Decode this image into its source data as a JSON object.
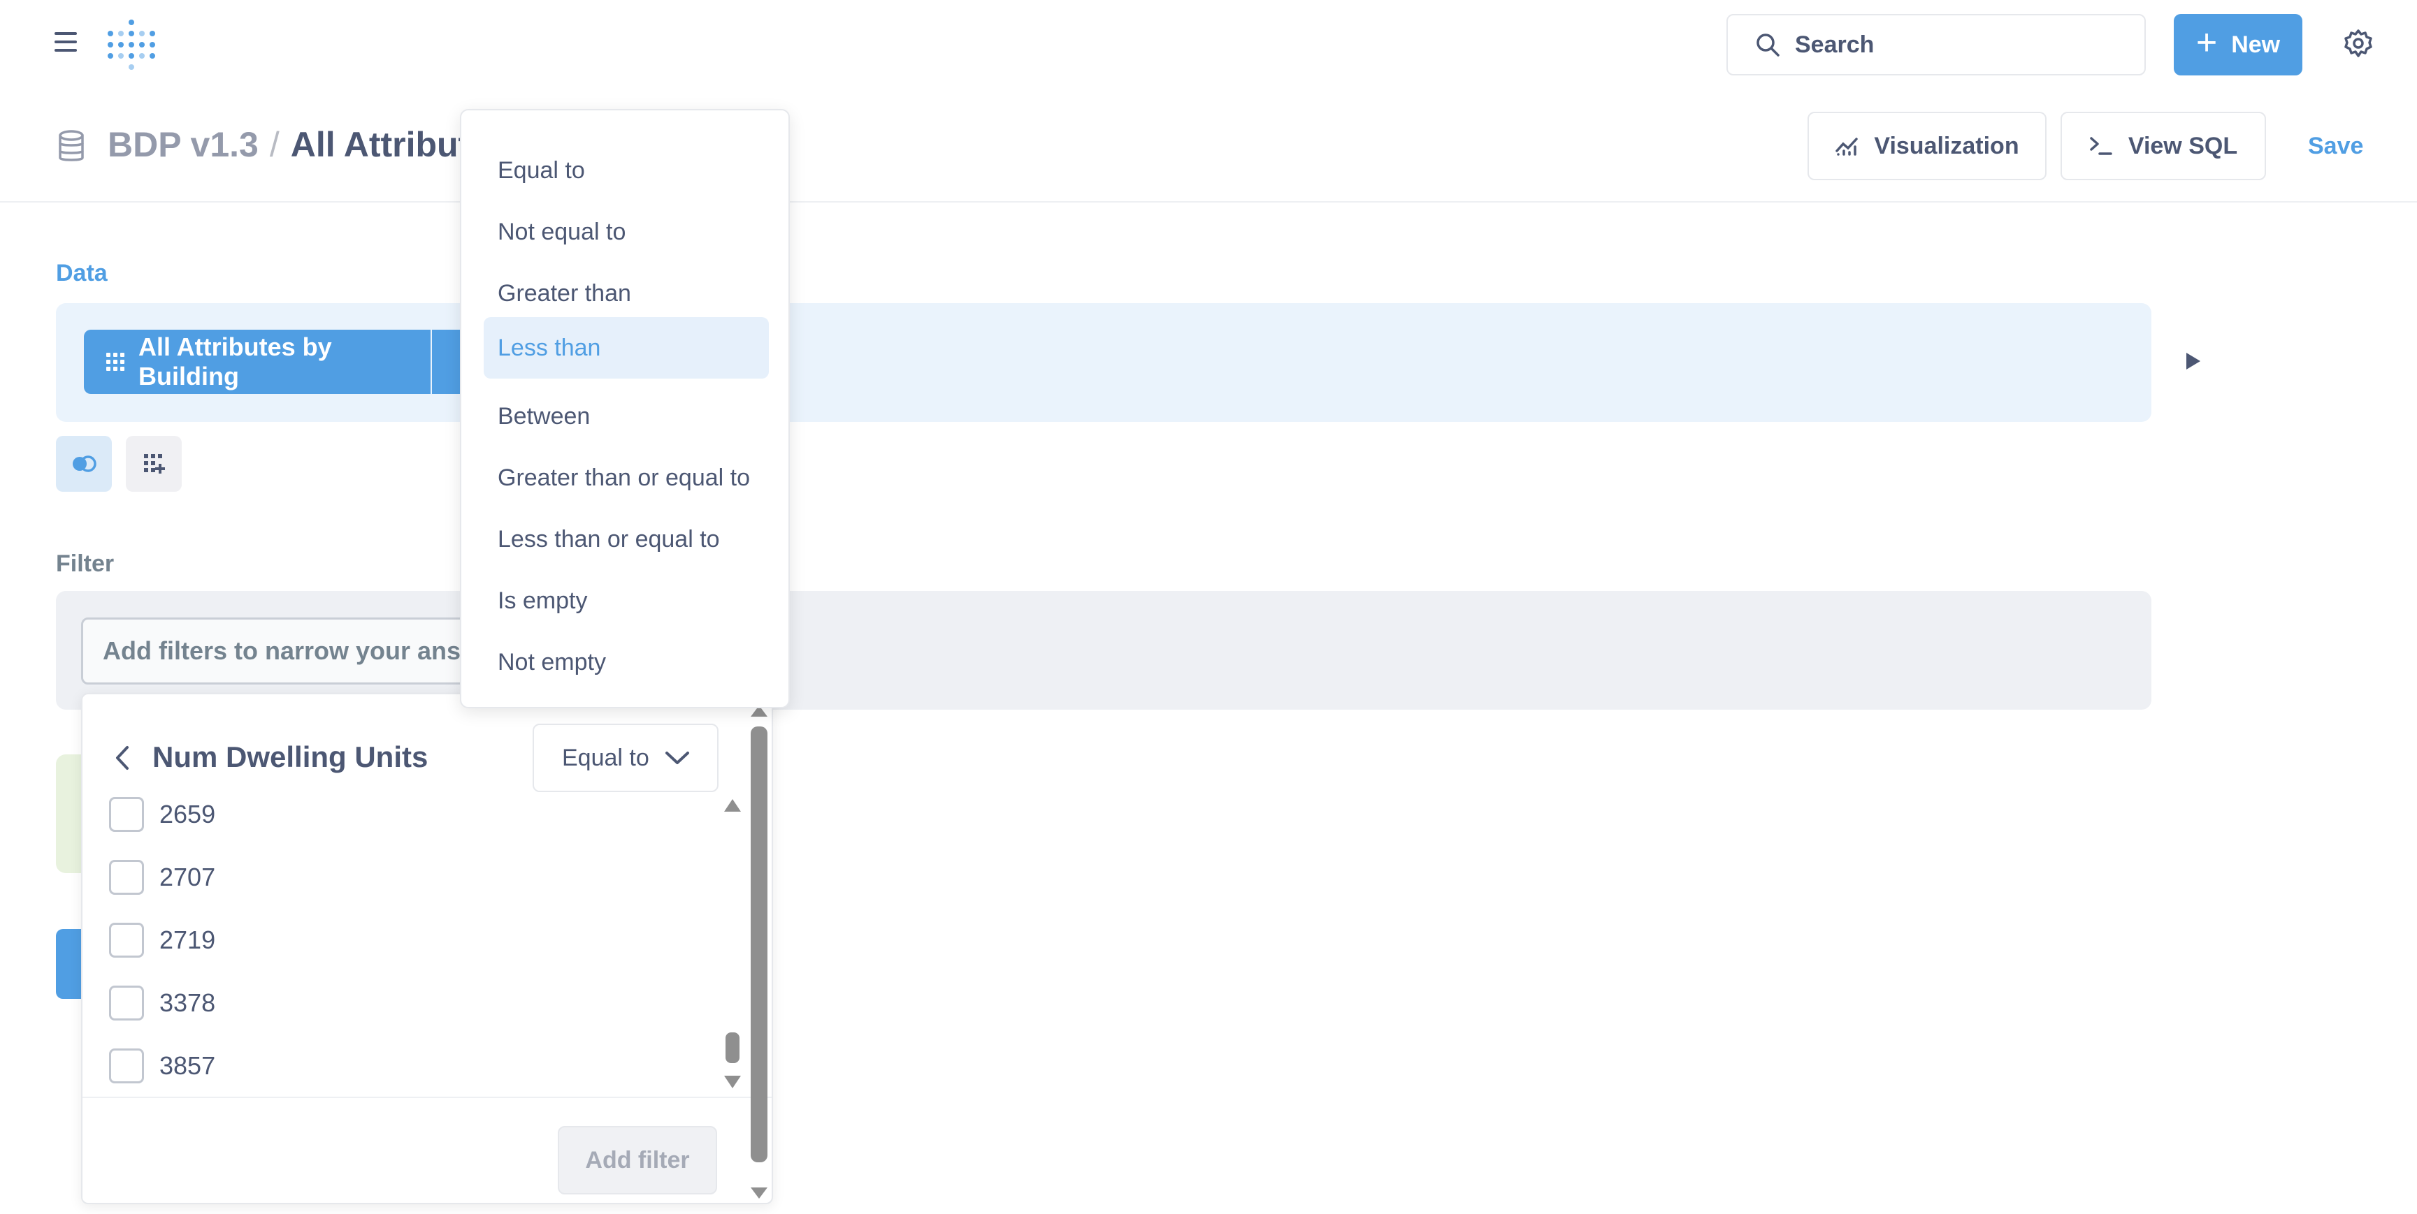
{
  "nav": {
    "search_placeholder": "Search",
    "new_label": "New"
  },
  "header": {
    "database": "BDP v1.3",
    "separator": "/",
    "question_title": "All Attribut",
    "visualization_label": "Visualization",
    "view_sql_label": "View SQL",
    "save_label": "Save"
  },
  "notebook": {
    "data_label": "Data",
    "data_source": "All Attributes by Building",
    "filter_label": "Filter",
    "filter_placeholder": "Add filters to narrow your answer"
  },
  "filter_popover": {
    "field_name": "Num Dwelling Units",
    "operator": "Equal to",
    "values": [
      {
        "label": "2659",
        "checked": false
      },
      {
        "label": "2707",
        "checked": false
      },
      {
        "label": "2719",
        "checked": false
      },
      {
        "label": "3378",
        "checked": false
      },
      {
        "label": "3857",
        "checked": false
      }
    ],
    "add_filter_label": "Add filter"
  },
  "operator_menu": {
    "items": [
      {
        "label": "Equal to",
        "active": false
      },
      {
        "label": "Not equal to",
        "active": false
      },
      {
        "label": "Greater than",
        "active": false
      },
      {
        "label": "Less than",
        "active": true
      },
      {
        "label": "Between",
        "active": false
      },
      {
        "label": "Greater than or equal to",
        "active": false
      },
      {
        "label": "Less than or equal to",
        "active": false
      },
      {
        "label": "Is empty",
        "active": false
      },
      {
        "label": "Not empty",
        "active": false
      }
    ]
  },
  "icons": {
    "menu": "hamburger-icon",
    "logo": "metabase-logo",
    "search": "search-icon",
    "new": "plus-icon",
    "settings": "gear-icon",
    "database": "database-icon",
    "visualization": "line-chart-icon",
    "sql": "terminal-icon",
    "run": "play-icon",
    "join": "join-icon",
    "custom_column": "grid-plus-icon",
    "back": "chevron-left-icon",
    "operator_caret": "chevron-down-icon"
  },
  "colors": {
    "brand": "#509ee3",
    "text": "#4c5773",
    "muted": "#949aab",
    "data_section_bg": "#eaf3fc",
    "filter_section_bg": "#eef0f4",
    "active_menu_bg": "#e6f0fb"
  }
}
